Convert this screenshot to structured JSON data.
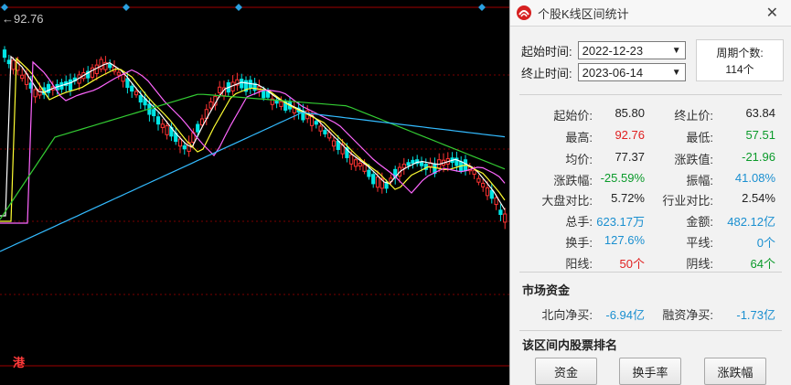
{
  "chart": {
    "price_label": "92.76",
    "hk_badge": "港",
    "colors": {
      "up": "#ff3333",
      "down": "#00e5e5",
      "ma5": "#ffffff",
      "ma10": "#ffff33",
      "ma20": "#ff66ff",
      "ma30": "#33cc33",
      "ma60": "#33bbff",
      "grid": "#7a0000",
      "marker": "#2aa0e0"
    }
  },
  "panel": {
    "title": "个股K线区间统计",
    "close_icon": "close-icon",
    "start_label": "起始时间:",
    "start_date": "2022-12-23",
    "end_label": "终止时间:",
    "end_date": "2023-06-14",
    "period_label": "周期个数:",
    "period_value": "114个",
    "stats": [
      {
        "l1": "起始价:",
        "v1": "85.80",
        "c1": "black",
        "l2": "终止价:",
        "v2": "63.84",
        "c2": "black"
      },
      {
        "l1": "最高:",
        "v1": "92.76",
        "c1": "red",
        "l2": "最低:",
        "v2": "57.51",
        "c2": "green"
      },
      {
        "l1": "均价:",
        "v1": "77.37",
        "c1": "black",
        "l2": "涨跌值:",
        "v2": "-21.96",
        "c2": "green"
      },
      {
        "l1": "涨跌幅:",
        "v1": "-25.59%",
        "c1": "green",
        "l2": "振幅:",
        "v2": "41.08%",
        "c2": "blue"
      },
      {
        "l1": "大盘对比:",
        "v1": "5.72%",
        "c1": "black",
        "l2": "行业对比:",
        "v2": "2.54%",
        "c2": "black"
      },
      {
        "l1": "总手:",
        "v1": "623.17万",
        "c1": "blue",
        "l2": "金额:",
        "v2": "482.12亿",
        "c2": "blue"
      },
      {
        "l1": "换手:",
        "v1": "127.6%",
        "c1": "blue",
        "l2": "平线:",
        "v2": "0个",
        "c2": "blue"
      },
      {
        "l1": "阳线:",
        "v1": "50个",
        "c1": "red",
        "l2": "阴线:",
        "v2": "64个",
        "c2": "green"
      }
    ],
    "fund_title": "市场资金",
    "fund": {
      "l1": "北向净买:",
      "v1": "-6.94亿",
      "l2": "融资净买:",
      "v2": "-1.73亿"
    },
    "rank_title": "该区间内股票排名",
    "buttons": [
      "资金",
      "换手率",
      "涨跌幅"
    ]
  }
}
